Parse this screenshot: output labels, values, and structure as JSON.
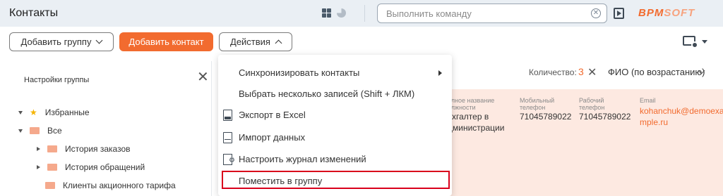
{
  "header": {
    "title": "Контакты",
    "command_placeholder": "Выполнить команду",
    "logo_main": "BPM",
    "logo_soft": "SOFT"
  },
  "toolbar": {
    "add_group_label": "Добавить группу",
    "add_contact_label": "Добавить контакт",
    "actions_label": "Действия"
  },
  "left_panel": {
    "title": "Настройки группы",
    "tree": [
      {
        "label": "Избранные"
      },
      {
        "label": "Все"
      },
      {
        "label": "История заказов"
      },
      {
        "label": "История обращений"
      },
      {
        "label": "Клиенты акционного тарифа"
      }
    ]
  },
  "grid": {
    "count_label": "Количество:",
    "count_value": "3",
    "sort_label": "ФИО (по возрастанию)",
    "columns": [
      {
        "header_line1": "олное название",
        "header_line2": "олжности",
        "value_line1": "ухгалтер в",
        "value_line2": "дминистрации"
      },
      {
        "header_line1": "Мобильный",
        "header_line2": "телефон",
        "value_line1": "71045789022",
        "value_line2": ""
      },
      {
        "header_line1": "Рабочий",
        "header_line2": "телефон",
        "value_line1": "71045789022",
        "value_line2": ""
      },
      {
        "header_line1": "Email",
        "header_line2": "",
        "value_line1": "kohanchuk@demoexa",
        "value_line2": "mple.ru"
      }
    ]
  },
  "actions_menu": {
    "items": [
      {
        "label": "Синхронизировать контакты"
      },
      {
        "label": "Выбрать несколько записей (Shift + ЛКМ)"
      },
      {
        "label": "Экспорт в Excel"
      },
      {
        "label": "Импорт данных"
      },
      {
        "label": "Настроить журнал изменений"
      },
      {
        "label": "Поместить в группу"
      }
    ]
  },
  "colors": {
    "accent": "#f26b2f",
    "highlight_border": "#d9001b",
    "row_selected": "#fde9e1"
  }
}
